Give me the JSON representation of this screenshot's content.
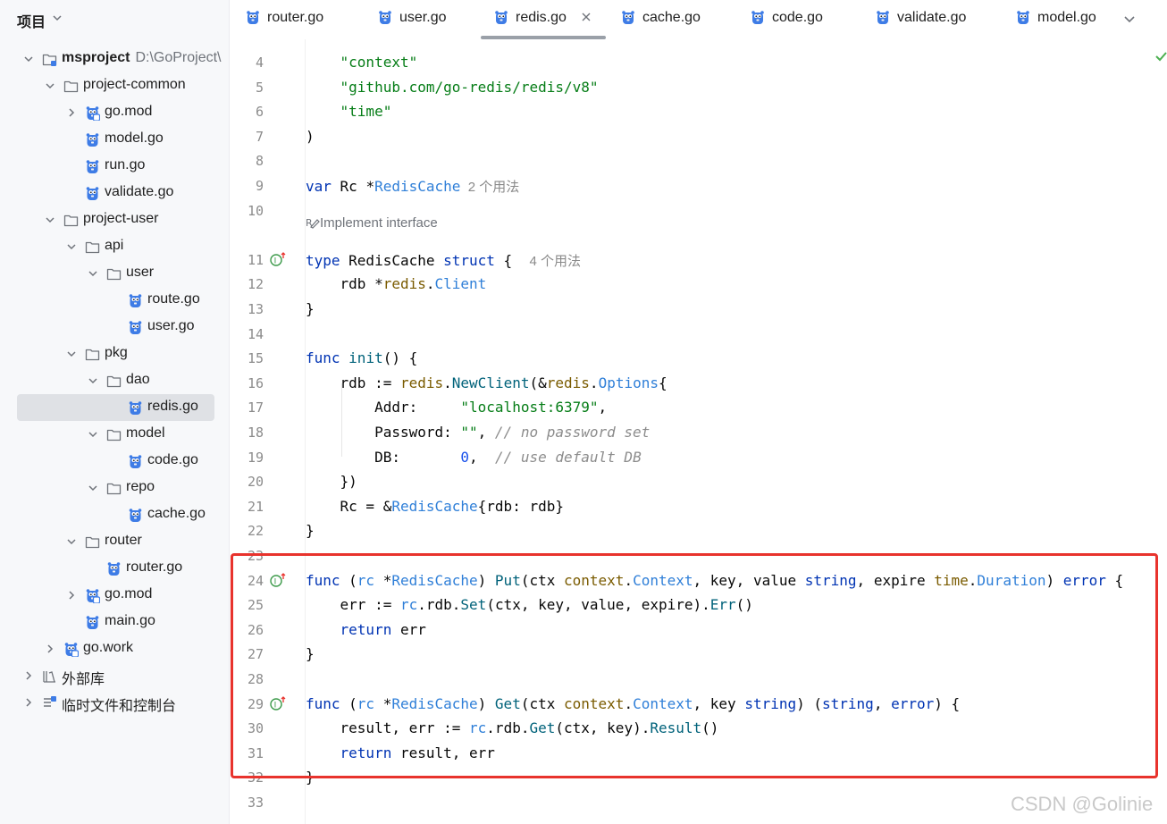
{
  "sidebar": {
    "title": "项目",
    "tree": [
      {
        "label": "msproject",
        "sub": "D:\\GoProject\\",
        "bold": true,
        "icon": "module-folder-icon",
        "expanded": true,
        "depth": 0
      },
      {
        "label": "project-common",
        "icon": "folder-icon",
        "expanded": true,
        "depth": 1
      },
      {
        "label": "go.mod",
        "icon": "gomod-file-icon",
        "expanded": false,
        "depth": 2
      },
      {
        "label": "model.go",
        "icon": "go-file-icon",
        "depth": 2
      },
      {
        "label": "run.go",
        "icon": "go-file-icon",
        "depth": 2
      },
      {
        "label": "validate.go",
        "icon": "go-file-icon",
        "depth": 2
      },
      {
        "label": "project-user",
        "icon": "folder-icon",
        "expanded": true,
        "depth": 1
      },
      {
        "label": "api",
        "icon": "folder-icon",
        "expanded": true,
        "depth": 2
      },
      {
        "label": "user",
        "icon": "folder-icon",
        "expanded": true,
        "depth": 3
      },
      {
        "label": "route.go",
        "icon": "go-file-icon",
        "depth": 4
      },
      {
        "label": "user.go",
        "icon": "go-file-icon",
        "depth": 4
      },
      {
        "label": "pkg",
        "icon": "folder-icon",
        "expanded": true,
        "depth": 2
      },
      {
        "label": "dao",
        "icon": "folder-icon",
        "expanded": true,
        "depth": 3
      },
      {
        "label": "redis.go",
        "icon": "go-file-icon",
        "depth": 4,
        "selected": true
      },
      {
        "label": "model",
        "icon": "folder-icon",
        "expanded": true,
        "depth": 3
      },
      {
        "label": "code.go",
        "icon": "go-file-icon",
        "depth": 4
      },
      {
        "label": "repo",
        "icon": "folder-icon",
        "expanded": true,
        "depth": 3
      },
      {
        "label": "cache.go",
        "icon": "go-file-icon",
        "depth": 4
      },
      {
        "label": "router",
        "icon": "folder-icon",
        "expanded": true,
        "depth": 2
      },
      {
        "label": "router.go",
        "icon": "go-file-icon",
        "depth": 3
      },
      {
        "label": "go.mod",
        "icon": "gomod-file-icon",
        "expanded": false,
        "depth": 2
      },
      {
        "label": "main.go",
        "icon": "go-file-icon",
        "depth": 2
      },
      {
        "label": "go.work",
        "icon": "gowork-file-icon",
        "expanded": false,
        "depth": 1
      },
      {
        "label": "外部库",
        "icon": "library-icon",
        "expanded": false,
        "depth": 0
      },
      {
        "label": "临时文件和控制台",
        "icon": "scratches-icon",
        "expanded": false,
        "depth": 0
      }
    ]
  },
  "tabs": [
    {
      "label": "router.go",
      "active": false
    },
    {
      "label": "user.go",
      "active": false
    },
    {
      "label": "redis.go",
      "active": true
    },
    {
      "label": "cache.go",
      "active": false
    },
    {
      "label": "code.go",
      "active": false
    },
    {
      "label": "validate.go",
      "active": false
    },
    {
      "label": "model.go",
      "active": false
    }
  ],
  "editor": {
    "implement_hint": "Implement interface",
    "lines": [
      {
        "n": "4",
        "segs": [
          [
            "    ",
            ""
          ],
          [
            "\"context\"",
            "str"
          ]
        ]
      },
      {
        "n": "5",
        "segs": [
          [
            "    ",
            ""
          ],
          [
            "\"github.com/go-redis/redis/v8\"",
            "str"
          ]
        ]
      },
      {
        "n": "6",
        "segs": [
          [
            "    ",
            ""
          ],
          [
            "\"time\"",
            "str"
          ]
        ]
      },
      {
        "n": "7",
        "segs": [
          [
            ")",
            ""
          ]
        ]
      },
      {
        "n": "8",
        "segs": []
      },
      {
        "n": "9",
        "segs": [
          [
            "var",
            "kw"
          ],
          [
            " Rc *",
            ""
          ],
          [
            "RedisCache",
            "rcv"
          ],
          [
            "  2 个用法",
            "hint"
          ]
        ]
      },
      {
        "n": "10",
        "segs": []
      },
      {
        "n": "11",
        "mark": "implemented",
        "segs": [
          [
            "type",
            "kw"
          ],
          [
            " RedisCache ",
            ""
          ],
          [
            "struct",
            "kw"
          ],
          [
            " {  ",
            ""
          ],
          [
            "4 个用法",
            "hint"
          ]
        ]
      },
      {
        "n": "12",
        "segs": [
          [
            "    rdb *",
            ""
          ],
          [
            "redis",
            "pkg"
          ],
          [
            ".",
            ""
          ],
          [
            "Client",
            "rcv"
          ]
        ]
      },
      {
        "n": "13",
        "segs": [
          [
            "}",
            ""
          ]
        ]
      },
      {
        "n": "14",
        "segs": []
      },
      {
        "n": "15",
        "segs": [
          [
            "func",
            "kw"
          ],
          [
            " ",
            ""
          ],
          [
            "init",
            "ty"
          ],
          [
            "() {",
            ""
          ]
        ]
      },
      {
        "n": "16",
        "segs": [
          [
            "    rdb := ",
            ""
          ],
          [
            "redis",
            "pkg"
          ],
          [
            ".",
            ""
          ],
          [
            "NewClient",
            "ty"
          ],
          [
            "(&",
            ""
          ],
          [
            "redis",
            "pkg"
          ],
          [
            ".",
            ""
          ],
          [
            "Options",
            "rcv"
          ],
          [
            "{",
            ""
          ]
        ]
      },
      {
        "n": "17",
        "segs": [
          [
            "        Addr:     ",
            ""
          ],
          [
            "\"localhost:6379\"",
            "str"
          ],
          [
            ",",
            ""
          ]
        ]
      },
      {
        "n": "18",
        "segs": [
          [
            "        Password: ",
            ""
          ],
          [
            "\"\"",
            "str"
          ],
          [
            ", ",
            ""
          ],
          [
            "// no password set",
            "cmt"
          ]
        ]
      },
      {
        "n": "19",
        "segs": [
          [
            "        DB:       ",
            ""
          ],
          [
            "0",
            "num"
          ],
          [
            ",  ",
            ""
          ],
          [
            "// use default DB",
            "cmt"
          ]
        ]
      },
      {
        "n": "20",
        "segs": [
          [
            "    })",
            ""
          ]
        ]
      },
      {
        "n": "21",
        "segs": [
          [
            "    Rc = &",
            ""
          ],
          [
            "RedisCache",
            "rcv"
          ],
          [
            "{rdb: rdb}",
            ""
          ]
        ]
      },
      {
        "n": "22",
        "segs": [
          [
            "}",
            ""
          ]
        ]
      },
      {
        "n": "23",
        "segs": []
      },
      {
        "n": "24",
        "mark": "implemented",
        "segs": [
          [
            "func",
            "kw"
          ],
          [
            " (",
            ""
          ],
          [
            "rc",
            "rcv"
          ],
          [
            " *",
            ""
          ],
          [
            "RedisCache",
            "rcv"
          ],
          [
            ") ",
            ""
          ],
          [
            "Put",
            "ty"
          ],
          [
            "(ctx ",
            ""
          ],
          [
            "context",
            "pkg"
          ],
          [
            ".",
            ""
          ],
          [
            "Context",
            "rcv"
          ],
          [
            ", key, value ",
            ""
          ],
          [
            "string",
            "kw"
          ],
          [
            ", expire ",
            ""
          ],
          [
            "time",
            "pkg"
          ],
          [
            ".",
            ""
          ],
          [
            "Duration",
            "rcv"
          ],
          [
            ") ",
            ""
          ],
          [
            "error",
            "kw"
          ],
          [
            " {",
            ""
          ]
        ]
      },
      {
        "n": "25",
        "segs": [
          [
            "    err := ",
            ""
          ],
          [
            "rc",
            "rcv"
          ],
          [
            ".rdb.",
            ""
          ],
          [
            "Set",
            "ty"
          ],
          [
            "(ctx, key, value, expire).",
            ""
          ],
          [
            "Err",
            "ty"
          ],
          [
            "()",
            ""
          ]
        ]
      },
      {
        "n": "26",
        "segs": [
          [
            "    ",
            ""
          ],
          [
            "return",
            "kw"
          ],
          [
            " err",
            ""
          ]
        ]
      },
      {
        "n": "27",
        "segs": [
          [
            "}",
            ""
          ]
        ]
      },
      {
        "n": "28",
        "segs": []
      },
      {
        "n": "29",
        "mark": "implemented",
        "segs": [
          [
            "func",
            "kw"
          ],
          [
            " (",
            ""
          ],
          [
            "rc",
            "rcv"
          ],
          [
            " *",
            ""
          ],
          [
            "RedisCache",
            "rcv"
          ],
          [
            ") ",
            ""
          ],
          [
            "Get",
            "ty"
          ],
          [
            "(ctx ",
            ""
          ],
          [
            "context",
            "pkg"
          ],
          [
            ".",
            ""
          ],
          [
            "Context",
            "rcv"
          ],
          [
            ", key ",
            ""
          ],
          [
            "string",
            "kw"
          ],
          [
            ") (",
            ""
          ],
          [
            "string",
            "kw"
          ],
          [
            ", ",
            ""
          ],
          [
            "error",
            "kw"
          ],
          [
            ") {",
            ""
          ]
        ]
      },
      {
        "n": "30",
        "segs": [
          [
            "    result, err := ",
            ""
          ],
          [
            "rc",
            "rcv"
          ],
          [
            ".rdb.",
            ""
          ],
          [
            "Get",
            "ty"
          ],
          [
            "(ctx, key).",
            ""
          ],
          [
            "Result",
            "ty"
          ],
          [
            "()",
            ""
          ]
        ]
      },
      {
        "n": "31",
        "segs": [
          [
            "    ",
            ""
          ],
          [
            "return",
            "kw"
          ],
          [
            " result, err",
            ""
          ]
        ]
      },
      {
        "n": "32",
        "segs": [
          [
            "}",
            ""
          ]
        ]
      },
      {
        "n": "33",
        "segs": []
      }
    ]
  },
  "watermark": "CSDN @Golinie",
  "colors": {
    "highlight_border": "#e8332d",
    "selection": "#dfe1e5",
    "keyword": "#0033b3",
    "string": "#067d17"
  }
}
